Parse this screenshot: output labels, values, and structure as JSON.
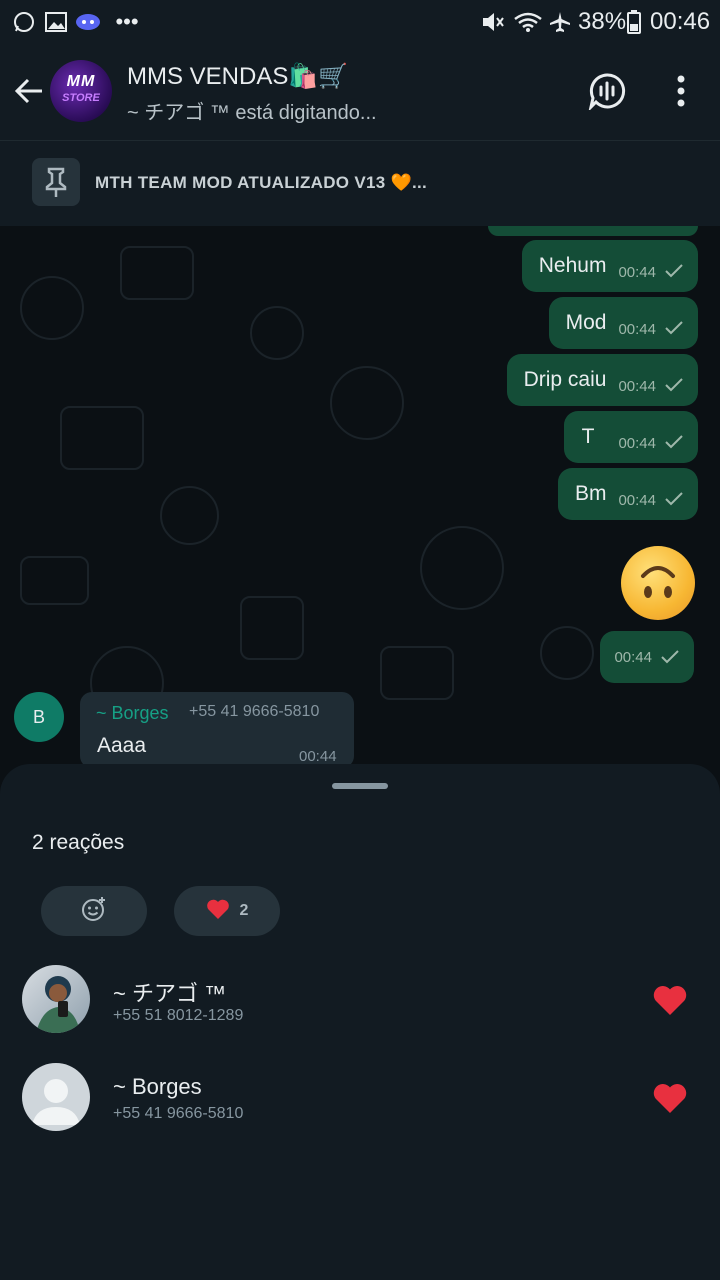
{
  "status_bar": {
    "battery": "38%",
    "time": "00:46"
  },
  "header": {
    "title": "MMS VENDAS🛍️🛒",
    "subtitle": "~ チアゴ ™ está digitando...",
    "avatar_text_top": "MM",
    "avatar_text_bottom": "STORE"
  },
  "pinned": {
    "text": "MTH TEAM MOD ATUALIZADO V13 🧡..."
  },
  "messages": [
    {
      "text": "Nehum",
      "time": "00:44"
    },
    {
      "text": "Mod",
      "time": "00:44"
    },
    {
      "text": "Drip caiu",
      "time": "00:44"
    },
    {
      "text": "T",
      "time": "00:44"
    },
    {
      "text": "Bm",
      "time": "00:44"
    },
    {
      "text": "",
      "time": "00:44",
      "emoji": "upside-down-face"
    }
  ],
  "incoming": {
    "avatar_letter": "B",
    "sender": "~ Borges",
    "phone": "+55 41 9666-5810",
    "text": "Aaaa",
    "time": "00:44"
  },
  "sheet": {
    "title": "2 reações",
    "chips": [
      {
        "icon": "add-reaction-icon",
        "count": ""
      },
      {
        "icon": "heart-icon",
        "count": "2"
      }
    ],
    "people": [
      {
        "name": "~ チアゴ ™",
        "phone": "+55 51 8012-1289",
        "reaction": "heart-icon"
      },
      {
        "name": "~ Borges",
        "phone": "+55 41 9666-5810",
        "reaction": "heart-icon"
      }
    ]
  },
  "colors": {
    "outgoing_bubble": "#144d37",
    "incoming_bubble": "#1f2c34",
    "accent_green": "#16a085",
    "background": "#0b1014"
  }
}
